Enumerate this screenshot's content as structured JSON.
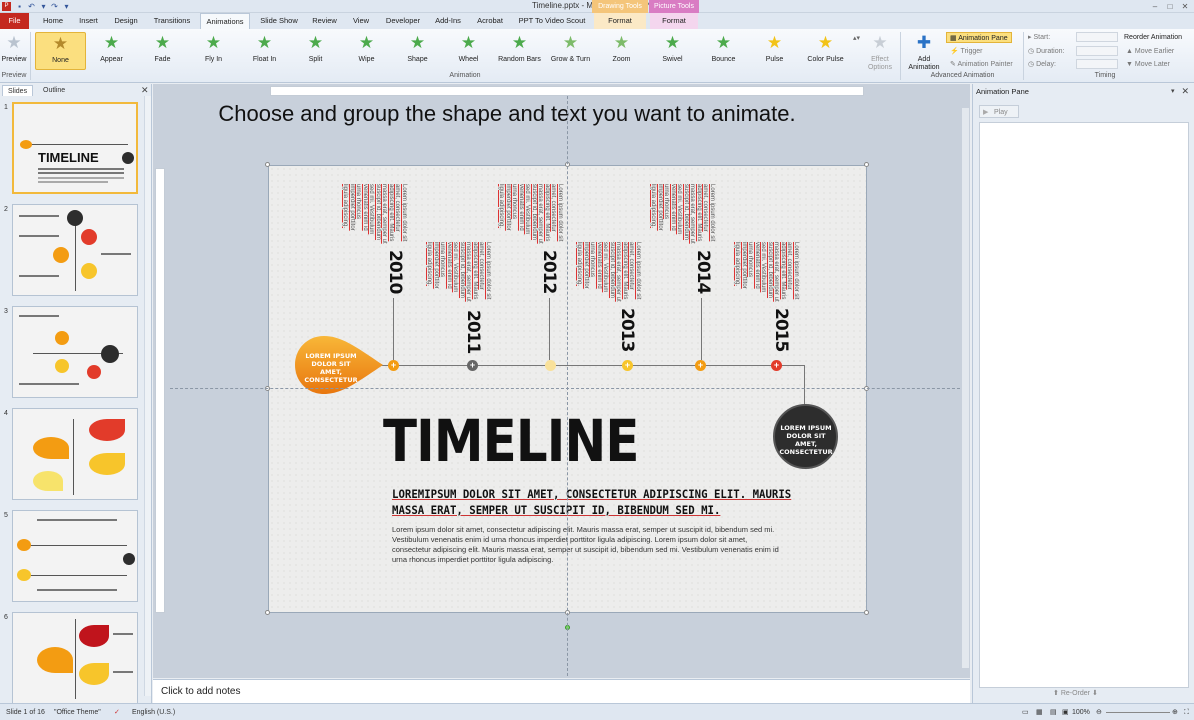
{
  "window": {
    "title": "Timeline.pptx - Microsoft PowerPoint",
    "contextual": [
      "Drawing Tools",
      "Picture Tools"
    ]
  },
  "tabs": [
    "File",
    "Home",
    "Insert",
    "Design",
    "Transitions",
    "Animations",
    "Slide Show",
    "Review",
    "View",
    "Developer",
    "Add-Ins",
    "Acrobat",
    "PPT To Video Scout",
    "Format",
    "Format"
  ],
  "active_tab": "Animations",
  "ribbon": {
    "preview_label": "Preview",
    "preview_group": "Preview",
    "animation_group": "Animation",
    "effects": [
      "None",
      "Appear",
      "Fade",
      "Fly In",
      "Float In",
      "Split",
      "Wipe",
      "Shape",
      "Wheel",
      "Random Bars",
      "Grow & Turn",
      "Zoom",
      "Swivel",
      "Bounce",
      "Pulse",
      "Color Pulse"
    ],
    "effect_options": "Effect Options",
    "add_animation": "Add Animation",
    "animation_pane": "Animation Pane",
    "trigger": "Trigger",
    "animation_painter": "Animation Painter",
    "advanced_group": "Advanced Animation",
    "start": "Start:",
    "duration": "Duration:",
    "delay": "Delay:",
    "timing_group": "Timing",
    "reorder": "Reorder Animation",
    "move_earlier": "Move Earlier",
    "move_later": "Move Later"
  },
  "left_panel": {
    "tabs": [
      "Slides",
      "Outline"
    ],
    "slide_numbers": [
      "1",
      "2",
      "3",
      "4",
      "5",
      "6"
    ]
  },
  "instruction": "Choose and group the shape and text you want to animate.",
  "slide": {
    "years": [
      "2010",
      "2011",
      "2012",
      "2013",
      "2014",
      "2015"
    ],
    "blurb": "Lorem ipsum dolor sit amet, consectetur adipiscing elit. Mauris massa erat, semper ut suscipit id, bibendum sed mi. Vestibulum venenatis enim id urna rhoncus imperdiet porttitor ligula adipiscing.",
    "drop_text": "LOREM IPSUM DOLOR SIT AMET, CONSECTETUR",
    "circle_text": "LOREM IPSUM DOLOR SIT AMET, CONSECTETUR",
    "title": "TIMELINE",
    "subhead": "LOREMIPSUM DOLOR SIT AMET, CONSECTETUR ADIPISCING ELIT. MAURIS MASSA ERAT, SEMPER UT SUSCIPIT ID, BIBENDUM SED MI.",
    "body": "Lorem ipsum dolor sit amet, consectetur adipiscing elit. Mauris massa erat, semper ut suscipit id, bibendum sed mi. Vestibulum venenatis enim id urna rhoncus imperdiet porttitor ligula adipiscing. Lorem ipsum dolor sit amet, consectetur adipiscing elit. Mauris massa erat, semper ut suscipit id, bibendum sed mi. Vestibulum venenatis enim id urna rhoncus imperdiet porttitor ligula adipiscing."
  },
  "notes_placeholder": "Click to add notes",
  "anim_pane": {
    "title": "Animation Pane",
    "play": "Play",
    "reorder": "Re-Order"
  },
  "status": {
    "slide": "Slide 1 of 16",
    "theme": "\"Office Theme\"",
    "language": "English (U.S.)",
    "zoom": "100%"
  },
  "colors": {
    "accent_orange": "#f39c12",
    "accent_red": "#e23b2a",
    "accent_yellow": "#f7c52b",
    "dark": "#2d2d2d",
    "file_tab": "#c4291f"
  }
}
